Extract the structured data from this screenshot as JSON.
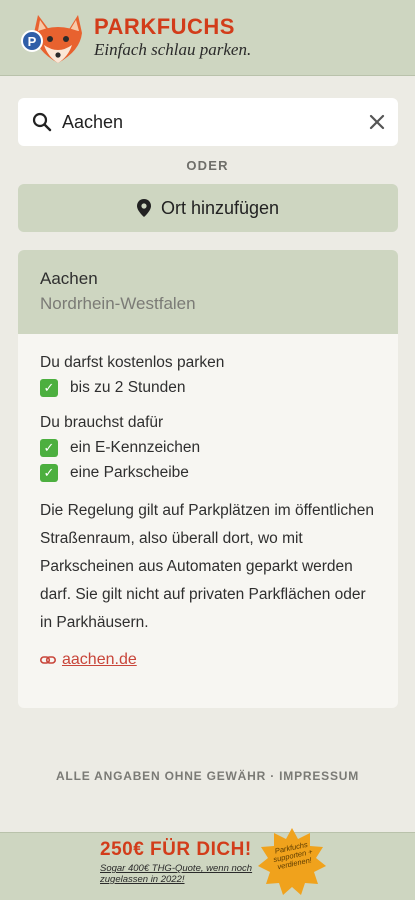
{
  "header": {
    "brand": "PARKFUCHS",
    "tagline": "Einfach schlau parken.",
    "logo_icon": "fox-parking-logo-icon",
    "brand_color": "#d23c1a"
  },
  "search": {
    "icon": "search-icon",
    "value": "Aachen",
    "clear_icon": "close-icon"
  },
  "divider_text": "ODER",
  "add_place": {
    "icon": "map-pin-icon",
    "label": "Ort hinzufügen"
  },
  "result": {
    "city": "Aachen",
    "state": "Nordrhein-Westfalen",
    "free_title": "Du darfst kostenlos parken",
    "free_items": [
      "bis zu 2 Stunden"
    ],
    "need_title": "Du brauchst dafür",
    "need_items": [
      "ein E-Kennzeichen",
      "eine Parkscheibe"
    ],
    "check_icon": "check-mark-icon",
    "description": "Die Regelung gilt auf Parkplätzen im öffentlichen Straßenraum, also überall dort, wo mit Parkscheinen aus Automaten geparkt werden darf. Sie gilt nicht auf privaten Parkflächen oder in Parkhäusern.",
    "link_icon": "link-icon",
    "link_text": "aachen.de"
  },
  "footer": {
    "disclaimer": "ALLE ANGABEN OHNE GEWÄHR",
    "separator": "·",
    "imprint": "IMPRESSUM"
  },
  "promo": {
    "title": "250€ FÜR DICH!",
    "subtitle": "Sogar 400€ THG-Quote, wenn noch zugelassen in 2022!",
    "badge_text": "Parkfuchs supporten + verdienen!",
    "badge_color": "#f0a21c"
  }
}
